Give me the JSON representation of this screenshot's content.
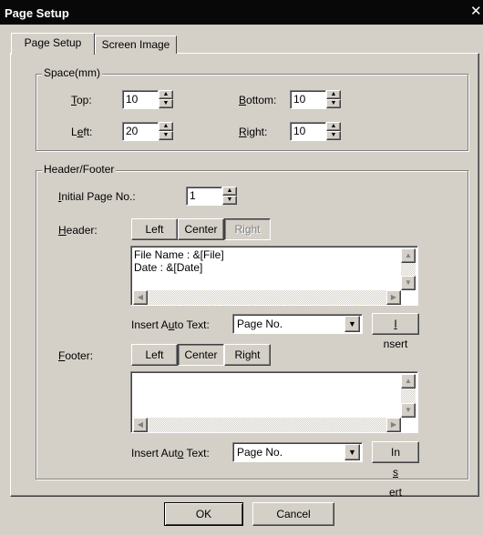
{
  "window": {
    "title": "Page Setup",
    "close_glyph": "✕"
  },
  "tabs": [
    {
      "label": "Page Setup",
      "active": true
    },
    {
      "label": "Screen Image",
      "active": false
    }
  ],
  "space": {
    "group_label": "Space(mm)",
    "top": {
      "label_u": "T",
      "label_rest": "op:",
      "value": "10"
    },
    "left": {
      "label_pre": "L",
      "label_u": "e",
      "label_rest": "ft:",
      "value": "20"
    },
    "bottom": {
      "label_u": "B",
      "label_rest": "ottom:",
      "value": "10"
    },
    "right": {
      "label_u": "R",
      "label_rest": "ight:",
      "value": "10"
    }
  },
  "header_footer": {
    "group_label": "Header/Footer",
    "initial_page": {
      "label_u": "I",
      "label_rest": "nitial Page No.:",
      "value": "1"
    },
    "header": {
      "label_u": "H",
      "label_rest": "eader:",
      "buttons": [
        "Left",
        "Center",
        "Right"
      ],
      "text": "File Name : &[File]\nDate : &[Date]",
      "auto_text_label_pre": "Insert A",
      "auto_text_label_u": "u",
      "auto_text_label_rest": "to Text:",
      "auto_text_value": "Page No.",
      "insert_label_u": "I",
      "insert_label_rest": "nsert"
    },
    "footer": {
      "label_u": "F",
      "label_rest": "ooter:",
      "buttons": [
        "Left",
        "Center",
        "Right"
      ],
      "text": "",
      "auto_text_label_pre": "Insert Aut",
      "auto_text_label_u": "o",
      "auto_text_label_rest": " Text:",
      "auto_text_value": "Page No.",
      "insert_label_pre": "In",
      "insert_label_u": "s",
      "insert_label_rest": "ert"
    }
  },
  "buttons": {
    "ok": "OK",
    "cancel": "Cancel"
  }
}
